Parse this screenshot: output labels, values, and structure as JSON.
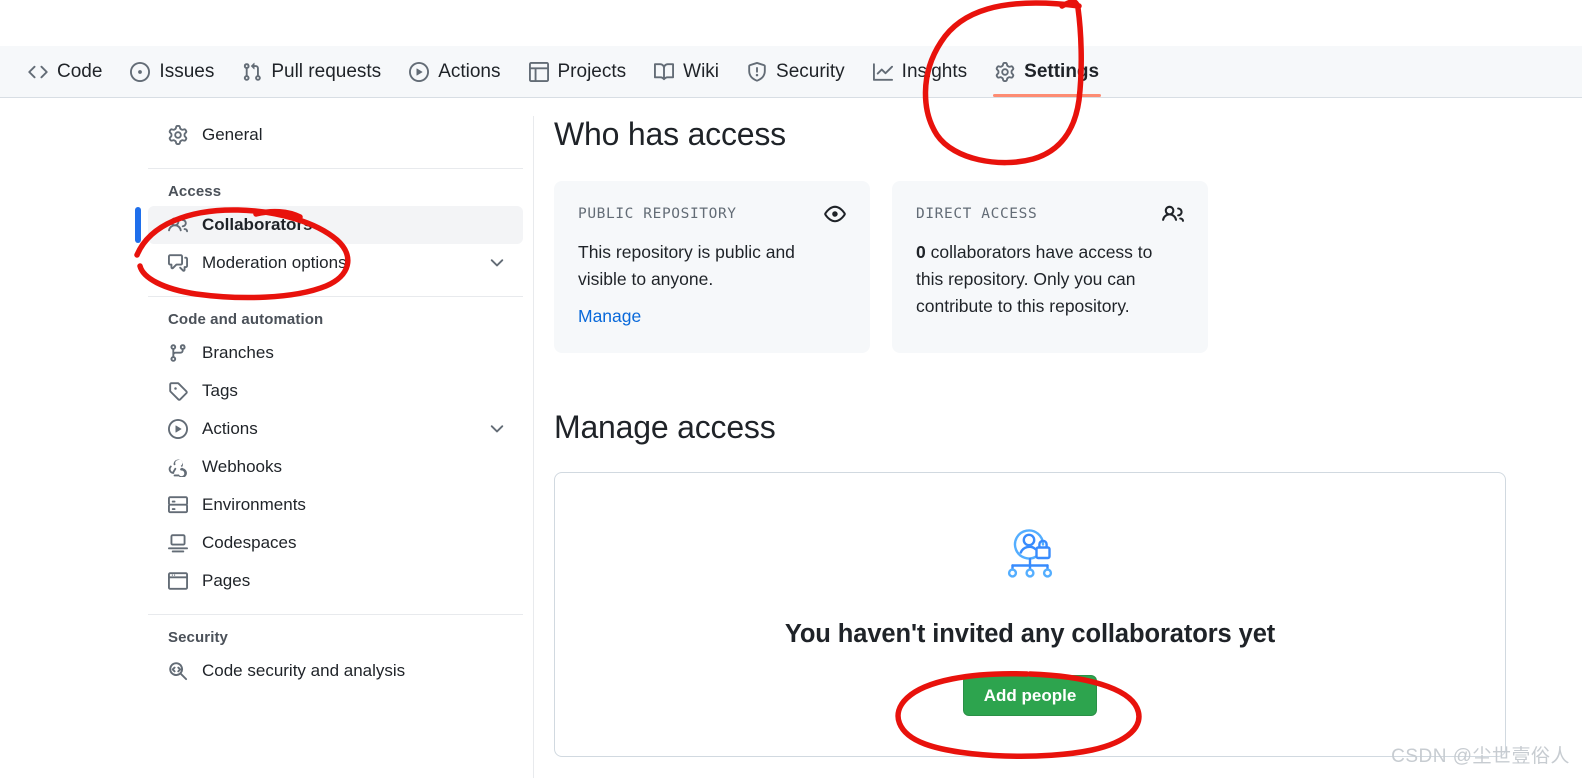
{
  "repo_nav": {
    "items": [
      {
        "label": "Code",
        "icon": "code-icon",
        "active": false
      },
      {
        "label": "Issues",
        "icon": "issue-opened-icon",
        "active": false
      },
      {
        "label": "Pull requests",
        "icon": "git-pull-request-icon",
        "active": false
      },
      {
        "label": "Actions",
        "icon": "play-icon",
        "active": false
      },
      {
        "label": "Projects",
        "icon": "table-icon",
        "active": false
      },
      {
        "label": "Wiki",
        "icon": "book-icon",
        "active": false
      },
      {
        "label": "Security",
        "icon": "shield-icon",
        "active": false
      },
      {
        "label": "Insights",
        "icon": "graph-icon",
        "active": false
      },
      {
        "label": "Settings",
        "icon": "gear-icon",
        "active": true
      }
    ],
    "active_underline_color": "#fd8c73"
  },
  "sidebar": {
    "top_item": {
      "label": "General",
      "icon": "gear-icon"
    },
    "groups": [
      {
        "title": "Access",
        "items": [
          {
            "label": "Collaborators",
            "icon": "people-icon",
            "selected": true,
            "chevron": false
          },
          {
            "label": "Moderation options",
            "icon": "comment-discussion-icon",
            "selected": false,
            "chevron": true
          }
        ]
      },
      {
        "title": "Code and automation",
        "items": [
          {
            "label": "Branches",
            "icon": "git-branch-icon",
            "selected": false,
            "chevron": false
          },
          {
            "label": "Tags",
            "icon": "tag-icon",
            "selected": false,
            "chevron": false
          },
          {
            "label": "Actions",
            "icon": "play-icon",
            "selected": false,
            "chevron": true
          },
          {
            "label": "Webhooks",
            "icon": "webhook-icon",
            "selected": false,
            "chevron": false
          },
          {
            "label": "Environments",
            "icon": "server-icon",
            "selected": false,
            "chevron": false
          },
          {
            "label": "Codespaces",
            "icon": "codespaces-icon",
            "selected": false,
            "chevron": false
          },
          {
            "label": "Pages",
            "icon": "browser-icon",
            "selected": false,
            "chevron": false
          }
        ]
      },
      {
        "title": "Security",
        "items": [
          {
            "label": "Code security and analysis",
            "icon": "code-review-icon",
            "selected": false,
            "chevron": false
          }
        ]
      }
    ],
    "selected_indicator_color": "#1f6feb"
  },
  "main": {
    "who_has_access": {
      "title": "Who has access",
      "cards": [
        {
          "kicker": "PUBLIC REPOSITORY",
          "icon": "eye-icon",
          "body": "This repository is public and visible to anyone.",
          "link": "Manage"
        },
        {
          "kicker": "DIRECT ACCESS",
          "icon": "people-icon",
          "body_strong": "0",
          "body": " collaborators have access to this repository. Only you can contribute to this repository.",
          "link": ""
        }
      ]
    },
    "manage_access": {
      "title": "Manage access",
      "empty_state": {
        "illustration": "person-lock-hierarchy-illustration",
        "heading": "You haven't invited any collaborators yet",
        "button_label": "Add people",
        "button_color": "#2da44e"
      }
    }
  },
  "annotations": {
    "color": "#e8120c",
    "shapes": [
      "circle-around-settings-tab",
      "circle-around-collaborators-sidebar-item",
      "circle-around-add-people-button"
    ]
  },
  "watermark": {
    "text": "CSDN @尘世壹俗人"
  }
}
